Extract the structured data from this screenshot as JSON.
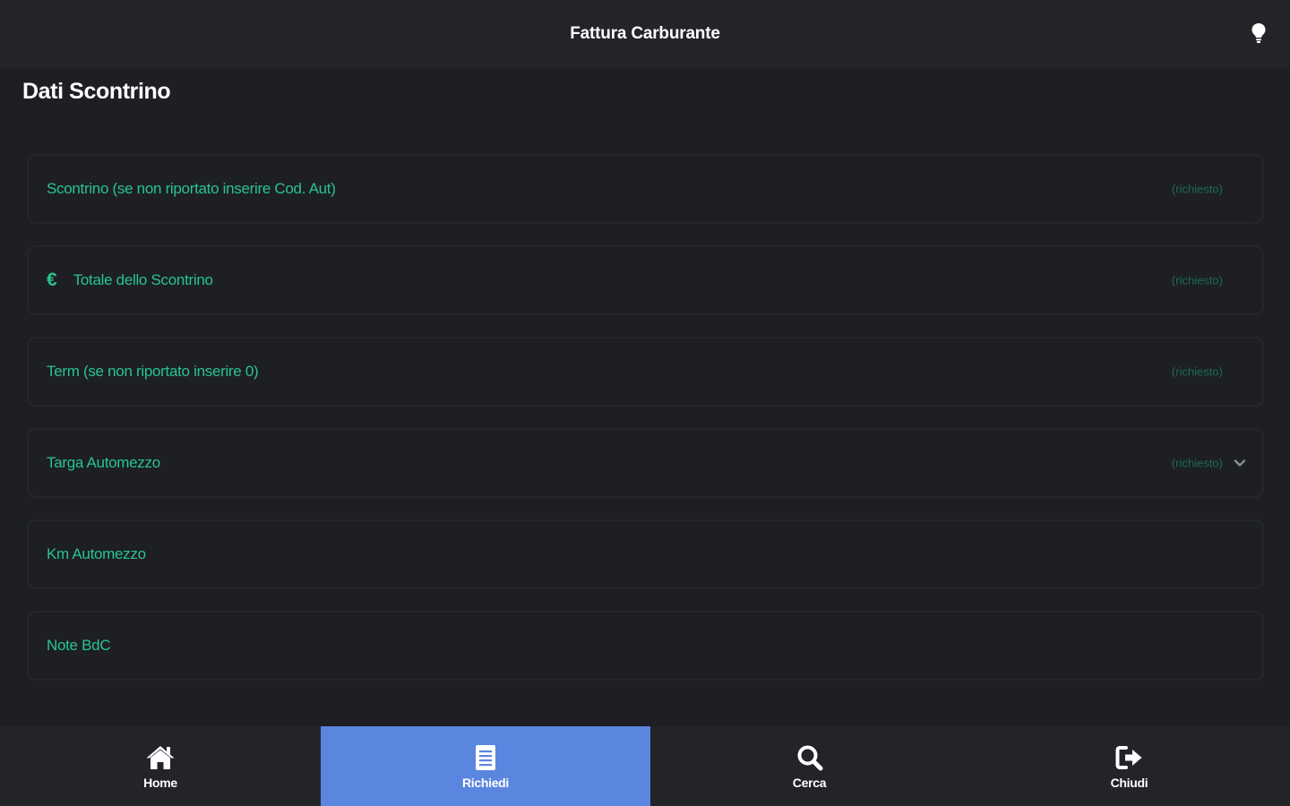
{
  "header": {
    "title": "Fattura Carburante",
    "right_icon": "lightbulb-icon"
  },
  "section": {
    "title": "Dati Scontrino"
  },
  "form": {
    "fields": [
      {
        "label": "Scontrino (se non riportato inserire Cod. Aut)",
        "hint": "(richiesto)"
      },
      {
        "label": "Totale dello Scontrino",
        "hint": "(richiesto)",
        "prefix": "€"
      },
      {
        "label": "Term (se non riportato inserire 0)",
        "hint": "(richiesto)"
      },
      {
        "label": "Targa Automezzo",
        "hint": "(richiesto)"
      },
      {
        "label": "Km Automezzo"
      },
      {
        "label": "Note BdC"
      }
    ]
  },
  "nav": {
    "items": [
      {
        "label": "Home",
        "icon": "home-icon"
      },
      {
        "label": "Richiedi",
        "icon": "document-icon",
        "active": true
      },
      {
        "label": "Cerca",
        "icon": "search-icon"
      },
      {
        "label": "Chiudi",
        "icon": "logout-icon"
      }
    ]
  },
  "colors": {
    "background": "#1d1f24",
    "bar": "#222429",
    "accent_green": "#29c48d",
    "active_tab": "#5a86df"
  }
}
